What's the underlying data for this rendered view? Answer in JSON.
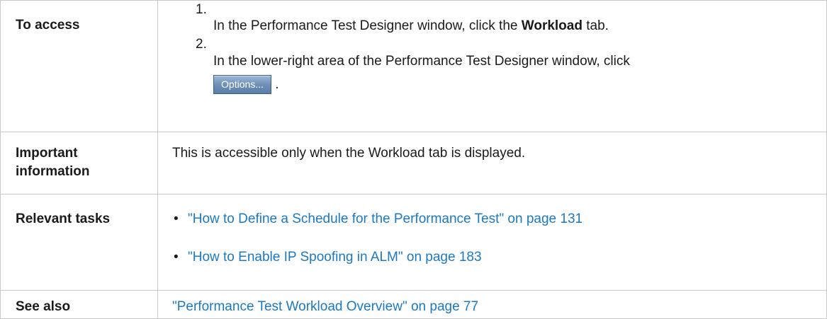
{
  "rows": {
    "access": {
      "label": "To access",
      "steps": [
        {
          "num": "1.",
          "text_before": "In the Performance Test Designer window, click the ",
          "bold": "Workload",
          "text_after": " tab."
        },
        {
          "num": "2.",
          "text_before": "In the lower-right area of the Performance Test Designer window, click",
          "button_label": "Options...",
          "text_after": "."
        }
      ]
    },
    "important": {
      "label_line1": "Important",
      "label_line2": "information",
      "text": "This is accessible only when the Workload tab is displayed."
    },
    "tasks": {
      "label": "Relevant tasks",
      "items": [
        {
          "bullet": "•",
          "link": "\"How to Define a Schedule for the Performance Test\" on page 131"
        },
        {
          "bullet": "•",
          "link": "\"How to Enable IP Spoofing in ALM\" on page 183"
        }
      ]
    },
    "see_also": {
      "label": "See also",
      "link": "\"Performance Test Workload Overview\" on page 77"
    }
  },
  "colors": {
    "link": "#1b79c4",
    "border": "#c8c8c8",
    "button": "#6f91b8"
  }
}
